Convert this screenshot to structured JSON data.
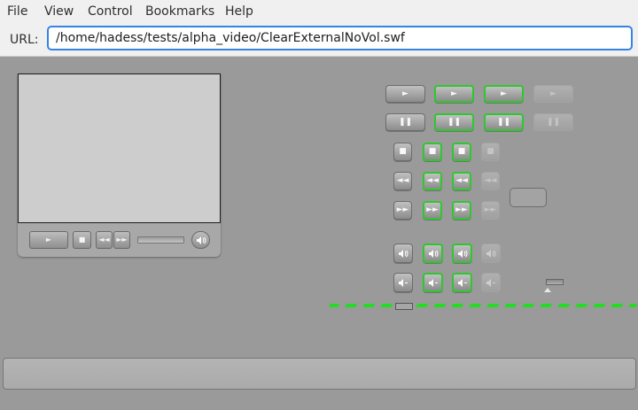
{
  "menubar": {
    "items": [
      "File",
      "View",
      "Control",
      "Bookmarks",
      "Help"
    ]
  },
  "urlbar": {
    "label": "URL:",
    "value": "/home/hadess/tests/alpha_video/ClearExternalNoVol.swf"
  },
  "colors": {
    "accent": "#3584e4",
    "hover_outline": "#2ec82e",
    "stage": "#9a9a9a",
    "video": "#cdcdcd"
  },
  "player": {
    "controls": [
      "play-icon",
      "stop-icon",
      "rewind-icon",
      "fast-forward-icon",
      "seek-bar",
      "volume-icon"
    ]
  },
  "button_states": [
    "normal",
    "hover",
    "pressed",
    "disabled"
  ],
  "button_groups": [
    {
      "name": "play",
      "icon": "play-icon"
    },
    {
      "name": "pause",
      "icon": "pause-icon"
    },
    {
      "name": "stop",
      "icon": "stop-icon"
    },
    {
      "name": "rewind",
      "icon": "rewind-icon"
    },
    {
      "name": "fast-forward",
      "icon": "fast-forward-icon"
    },
    {
      "name": "volume",
      "icon": "volume-icon"
    },
    {
      "name": "mute",
      "icon": "mute-icon"
    }
  ]
}
